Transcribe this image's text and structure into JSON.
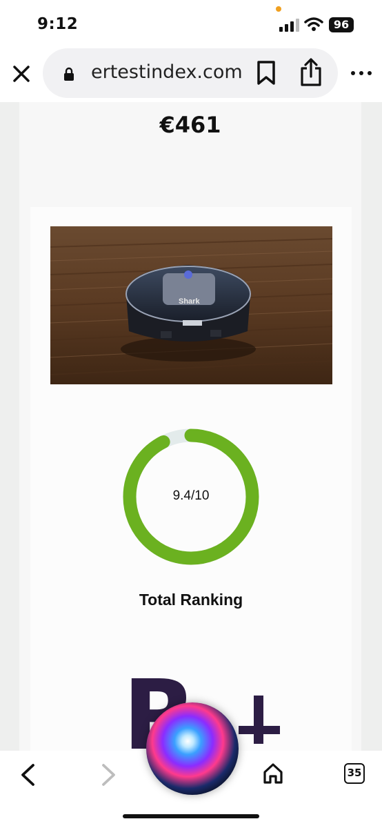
{
  "status_bar": {
    "time": "9:12",
    "battery": "96"
  },
  "browser": {
    "url": "ertestindex.com"
  },
  "page": {
    "price": "€461",
    "rating": {
      "value": 9.4,
      "max": 10,
      "text": "9.4/10"
    },
    "rank_label": "Total Ranking",
    "partial_text": "R+"
  },
  "toolbar": {
    "tab_count": "35"
  },
  "colors": {
    "ring_fill": "#6bb120",
    "ring_track": "#e3ebeb",
    "logo_text": "#2c1d44"
  }
}
